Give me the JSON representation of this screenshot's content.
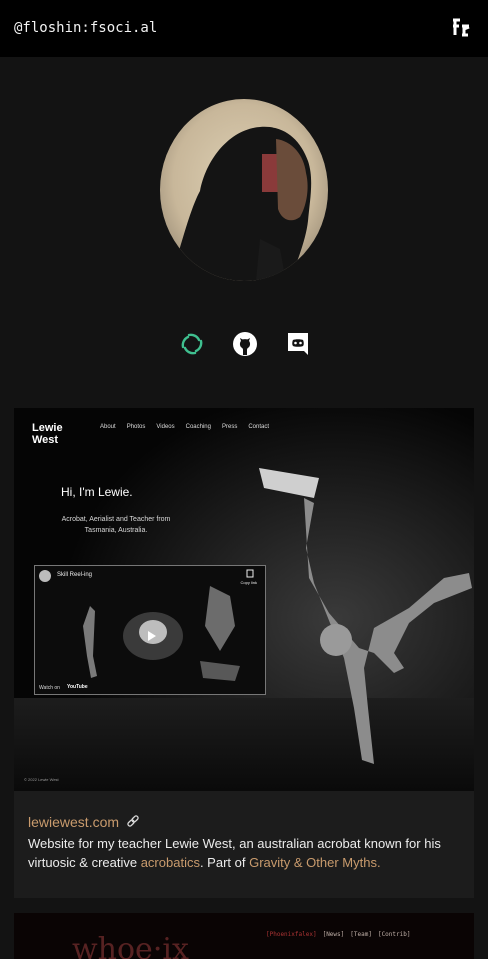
{
  "header": {
    "handle": "@floshin:fsoci.al",
    "logo_icon": "fr-monogram-icon"
  },
  "profile": {
    "avatar_icon": "hooded-profile-avatar"
  },
  "socials": [
    {
      "name": "element-matrix-icon",
      "color": "#3fbf8f"
    },
    {
      "name": "github-icon",
      "color": "#ffffff"
    },
    {
      "name": "discord-icon",
      "color": "#ffffff"
    }
  ],
  "project": {
    "preview": {
      "brand": "Lewie West",
      "nav": [
        "About",
        "Photos",
        "Videos",
        "Coaching",
        "Press",
        "Contact"
      ],
      "hero_title": "Hi, I'm Lewie.",
      "hero_subtitle": "Acrobat, Aerialist and Teacher from Tasmania, Australia.",
      "video_title": "Skill Reel-ing",
      "video_copy": "Copy link",
      "video_watch": "Watch on",
      "video_platform": "YouTube",
      "copyright": "© 2022 Lewie West"
    },
    "title": "lewiewest.com",
    "link_icon": "chain-link-icon",
    "desc_before": "Website for my teacher Lewie West, an australian acrobat known for his virtuosic & creative ",
    "desc_link1": "acrobatics",
    "desc_middle": ". Part of ",
    "desc_link2": "Gravity & Other Myths.",
    "accent_color": "#c99b6d"
  },
  "next_project": {
    "nav": [
      "[Phoenixfalex]",
      "[News]",
      "[Team]",
      "[Contrib]"
    ]
  }
}
